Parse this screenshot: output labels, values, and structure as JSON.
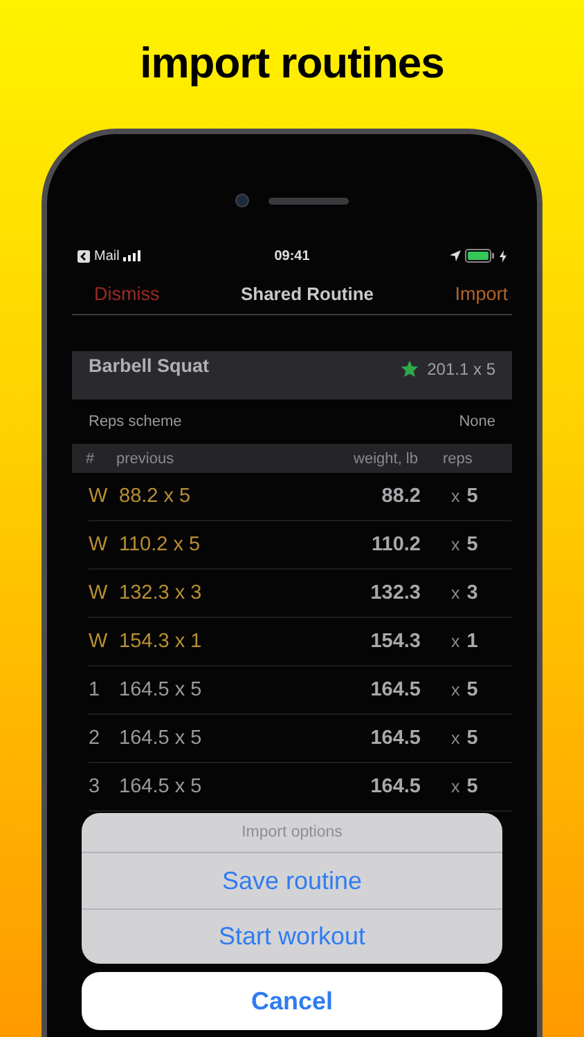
{
  "headline": "import routines",
  "status_bar": {
    "back_app": "Mail",
    "time": "09:41"
  },
  "nav": {
    "left": "Dismiss",
    "title": "Shared Routine",
    "right": "Import"
  },
  "exercise": {
    "name": "Barbell Squat",
    "record": "201.1 x 5"
  },
  "reps_scheme": {
    "label": "Reps scheme",
    "value": "None"
  },
  "table": {
    "columns": [
      "#",
      "previous",
      "weight, lb",
      "reps"
    ],
    "rows": [
      {
        "kind": "warmup",
        "set": "W",
        "previous": "88.2 x 5",
        "weight": "88.2",
        "times": "x",
        "reps": "5"
      },
      {
        "kind": "warmup",
        "set": "W",
        "previous": "110.2 x 5",
        "weight": "110.2",
        "times": "x",
        "reps": "5"
      },
      {
        "kind": "warmup",
        "set": "W",
        "previous": "132.3 x 3",
        "weight": "132.3",
        "times": "x",
        "reps": "3"
      },
      {
        "kind": "warmup",
        "set": "W",
        "previous": "154.3 x 1",
        "weight": "154.3",
        "times": "x",
        "reps": "1"
      },
      {
        "kind": "working",
        "set": "1",
        "previous": "164.5 x 5",
        "weight": "164.5",
        "times": "x",
        "reps": "5"
      },
      {
        "kind": "working",
        "set": "2",
        "previous": "164.5 x 5",
        "weight": "164.5",
        "times": "x",
        "reps": "5"
      },
      {
        "kind": "working",
        "set": "3",
        "previous": "164.5 x 5",
        "weight": "164.5",
        "times": "x",
        "reps": "5"
      }
    ]
  },
  "action_sheet": {
    "title": "Import options",
    "actions": [
      "Save routine",
      "Start workout"
    ],
    "cancel": "Cancel"
  }
}
